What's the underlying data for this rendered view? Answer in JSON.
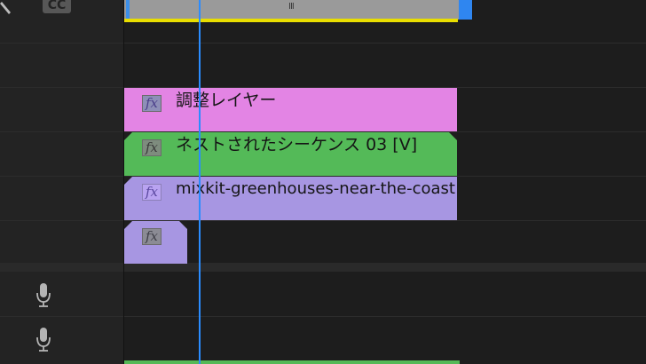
{
  "header": {
    "cc_label": "CC",
    "wrench_icon": "wrench-icon",
    "mic_icon": "microphone-icon"
  },
  "top_clip": {
    "grip_label": "III",
    "colors": {
      "body": "#9a9a9a",
      "underline": "#e9de00",
      "edge": "#2f86f0"
    }
  },
  "clips": [
    {
      "name": "調整レイヤー",
      "color": "#e384e4",
      "fx_label": "fx"
    },
    {
      "name": "ネストされたシーケンス 03 [V]",
      "color": "#54ba58",
      "fx_label": "fx"
    },
    {
      "name": "mixkit-greenhouses-near-the-coast",
      "color": "#a796e2",
      "fx_label": "fx"
    },
    {
      "name": "",
      "color": "#a796e2",
      "fx_label": "fx"
    }
  ],
  "playhead_color": "#2a8cff"
}
